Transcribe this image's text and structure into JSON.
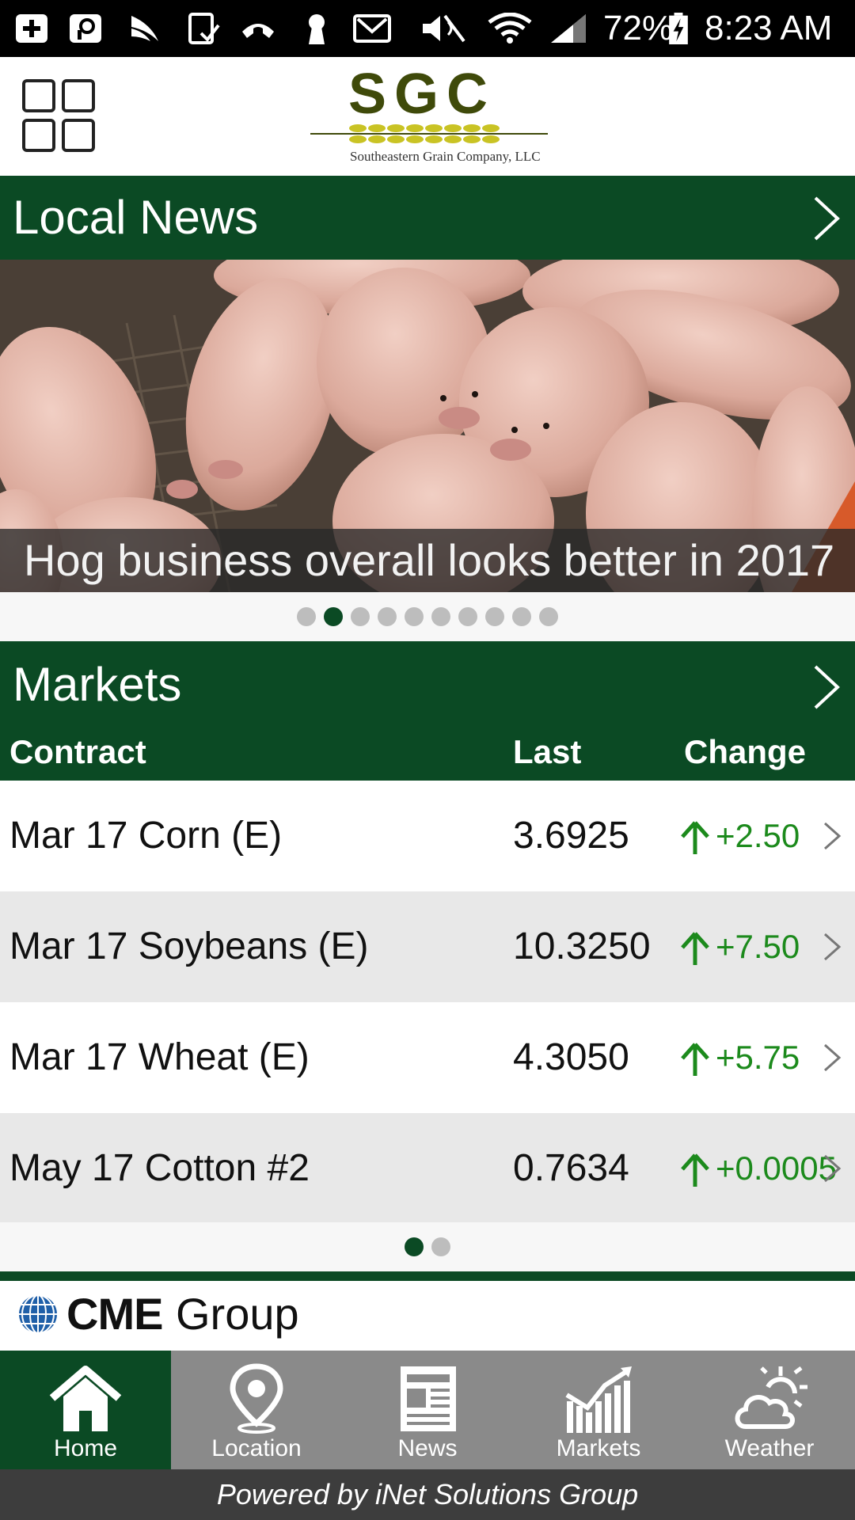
{
  "status_bar": {
    "battery": "72%",
    "time": "8:23 AM",
    "icons": [
      "add-box-icon",
      "search-box-icon",
      "sprint-icon",
      "tablet-check-icon",
      "voicemail-icon",
      "keyhole-icon",
      "gmail-icon",
      "mute-icon",
      "wifi-icon",
      "signal-icon",
      "battery-charging-icon"
    ]
  },
  "header": {
    "logo_title": "SGC",
    "logo_subtitle": "Southeastern Grain Company, LLC",
    "menu_icon": "grid-menu-icon"
  },
  "news": {
    "section_title": "Local News",
    "headline": "Hog business overall looks better in 2017",
    "slide_count": 10,
    "active_slide": 1
  },
  "markets": {
    "section_title": "Markets",
    "columns": {
      "contract": "Contract",
      "last": "Last",
      "change": "Change"
    },
    "rows": [
      {
        "contract": "Mar 17 Corn (E)",
        "last": "3.6925",
        "change": "+2.50",
        "direction": "up"
      },
      {
        "contract": "Mar 17 Soybeans (E)",
        "last": "10.3250",
        "change": "+7.50",
        "direction": "up"
      },
      {
        "contract": "Mar 17 Wheat (E)",
        "last": "4.3050",
        "change": "+5.75",
        "direction": "up"
      },
      {
        "contract": "May 17 Cotton #2",
        "last": "0.7634",
        "change": "+0.0005",
        "direction": "up"
      }
    ],
    "page_count": 2,
    "active_page": 0
  },
  "sponsor": {
    "name_bold": "CME",
    "name_light": "Group"
  },
  "bottom_nav": [
    {
      "label": "Home",
      "icon": "home-icon",
      "active": true
    },
    {
      "label": "Location",
      "icon": "location-pin-icon",
      "active": false
    },
    {
      "label": "News",
      "icon": "newspaper-icon",
      "active": false
    },
    {
      "label": "Markets",
      "icon": "chart-icon",
      "active": false
    },
    {
      "label": "Weather",
      "icon": "partly-cloudy-icon",
      "active": false
    }
  ],
  "footer": {
    "text": "Powered by iNet Solutions Group"
  },
  "colors": {
    "brand_green": "#0b4a24",
    "up_green": "#1c8a1c",
    "nav_gray": "#8a8a8a",
    "footer_gray": "#3d3d3d"
  }
}
